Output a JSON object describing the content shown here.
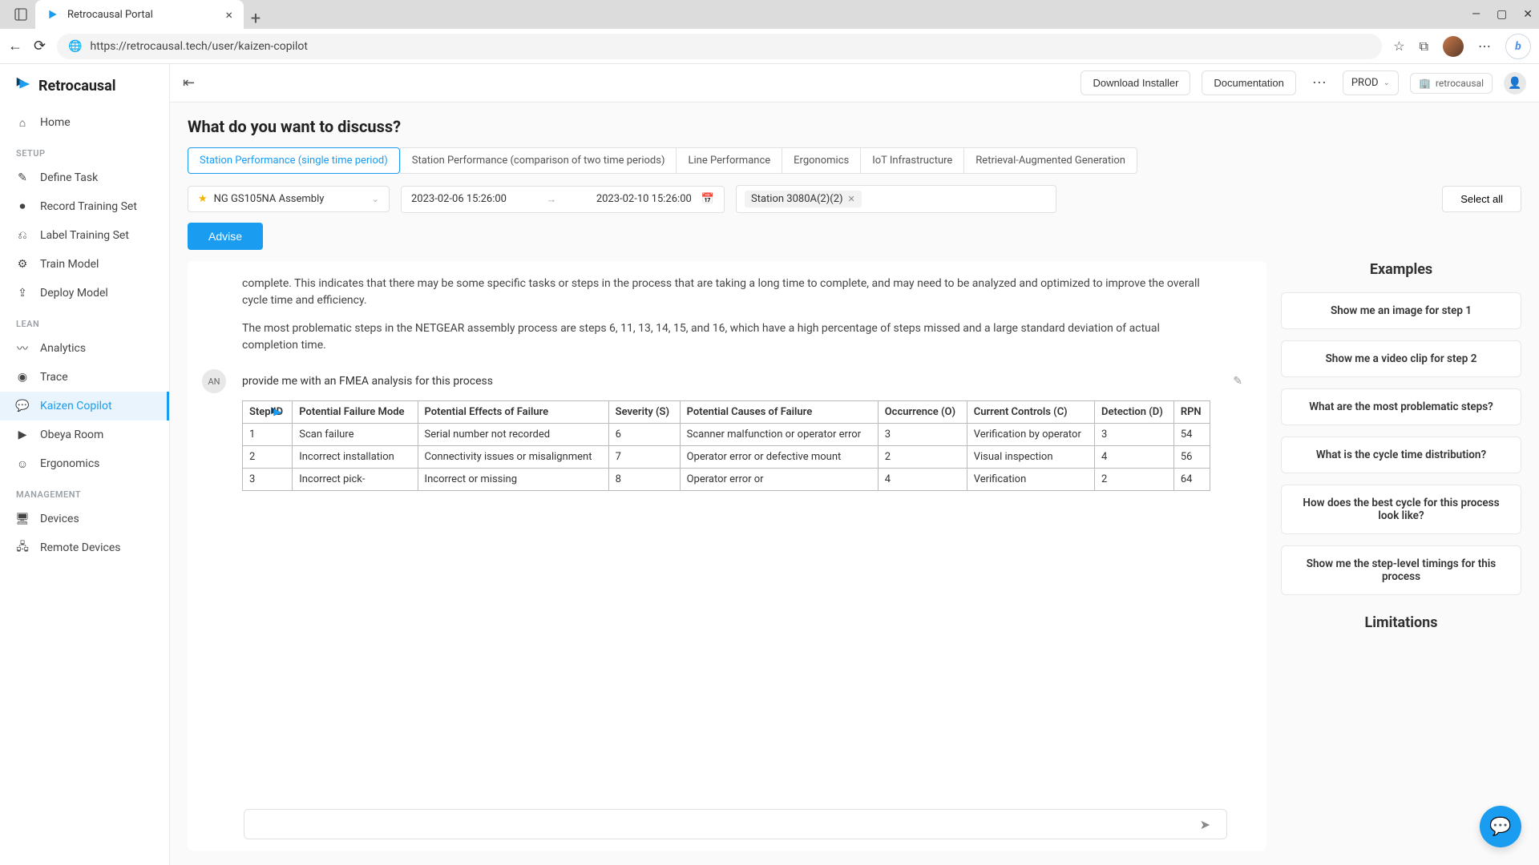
{
  "browser": {
    "tab_title": "Retrocausal Portal",
    "url": "https://retrocausal.tech/user/kaizen-copilot"
  },
  "brand": "Retrocausal",
  "sidebar": {
    "home": "Home",
    "sections": {
      "setup": "SETUP",
      "lean": "LEAN",
      "management": "MANAGEMENT"
    },
    "items": {
      "define_task": "Define Task",
      "record_training": "Record Training Set",
      "label_training": "Label Training Set",
      "train_model": "Train Model",
      "deploy_model": "Deploy Model",
      "analytics": "Analytics",
      "trace": "Trace",
      "kaizen": "Kaizen Copilot",
      "obeya": "Obeya Room",
      "ergonomics": "Ergonomics",
      "devices": "Devices",
      "remote_devices": "Remote Devices"
    }
  },
  "topbar": {
    "download": "Download Installer",
    "docs": "Documentation",
    "env": "PROD",
    "user": "retrocausal"
  },
  "page": {
    "title": "What do you want to discuss?",
    "tabs": [
      "Station Performance (single time period)",
      "Station Performance (comparison of two time periods)",
      "Line Performance",
      "Ergonomics",
      "IoT Infrastructure",
      "Retrieval-Augmented Generation"
    ],
    "task_select": "NG  GS105NA Assembly",
    "date_from": "2023-02-06 15:26:00",
    "date_to": "2023-02-10 15:26:00",
    "station": "Station 3080A(2)(2)",
    "select_all": "Select all",
    "advise": "Advise"
  },
  "chat": {
    "para1": "complete. This indicates that there may be some specific tasks or steps in the process that are taking a long time to complete, and may need to be analyzed and optimized to improve the overall cycle time and efficiency.",
    "para2": "The most problematic steps in the NETGEAR assembly process are steps 6, 11, 13, 14, 15, and 16, which have a high percentage of steps missed and a large standard deviation of actual completion time.",
    "user_initials": "AN",
    "user_msg": "provide me with an FMEA analysis for this process",
    "table": {
      "headers": [
        "Step ID",
        "Potential Failure Mode",
        "Potential Effects of Failure",
        "Severity (S)",
        "Potential Causes of Failure",
        "Occurrence (O)",
        "Current Controls (C)",
        "Detection (D)",
        "RPN"
      ],
      "rows": [
        [
          "1",
          "Scan failure",
          "Serial number not recorded",
          "6",
          "Scanner malfunction or operator error",
          "3",
          "Verification by operator",
          "3",
          "54"
        ],
        [
          "2",
          "Incorrect installation",
          "Connectivity issues or misalignment",
          "7",
          "Operator error or defective mount",
          "2",
          "Visual inspection",
          "4",
          "56"
        ],
        [
          "3",
          "Incorrect pick-",
          "Incorrect or missing",
          "8",
          "Operator error or",
          "4",
          "Verification",
          "2",
          "64"
        ]
      ]
    }
  },
  "examples": {
    "title": "Examples",
    "items": [
      "Show me an image for step 1",
      "Show me a video clip for step 2",
      "What are the most problematic steps?",
      "What is the cycle time distribution?",
      "How does the best cycle for this process look like?",
      "Show me the step-level timings for this process"
    ],
    "limitations": "Limitations"
  }
}
